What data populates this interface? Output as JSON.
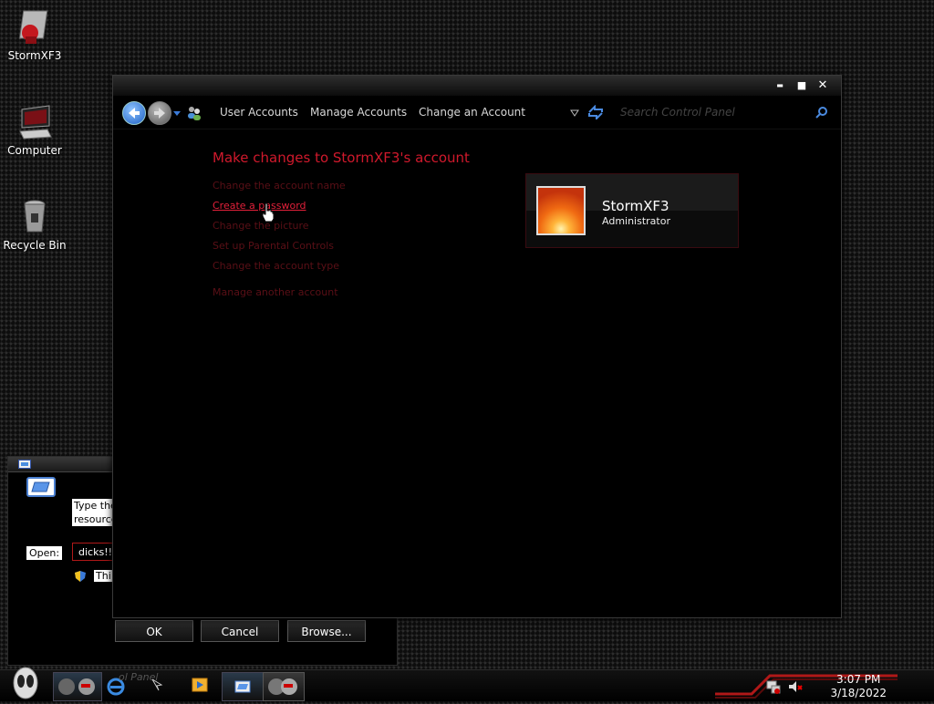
{
  "desktop": {
    "icons": [
      {
        "label": "StormXF3",
        "icon": "user-folder-icon"
      },
      {
        "label": "Computer",
        "icon": "computer-icon"
      },
      {
        "label": "Recycle Bin",
        "icon": "recycle-bin-icon"
      }
    ]
  },
  "run_dialog": {
    "description": "Type the resource",
    "open_label": "Open:",
    "open_value": "dicks!!!",
    "uac_note": "Thi",
    "ok_label": "OK",
    "cancel_label": "Cancel",
    "browse_label": "Browse..."
  },
  "window": {
    "breadcrumbs": [
      "User Accounts",
      "Manage Accounts",
      "Change an Account"
    ],
    "search_placeholder": "Search Control Panel",
    "controls": {
      "minimize": "▬",
      "maximize": "■",
      "close": "✕"
    }
  },
  "page": {
    "heading": "Make changes to StormXF3's account",
    "tasks": [
      "Change the account name",
      "Create a password",
      "Change the picture",
      "Set up Parental Controls",
      "Change the account type",
      "Manage another account"
    ],
    "active_task_index": 1
  },
  "account": {
    "name": "StormXF3",
    "role": "Administrator"
  },
  "taskbar": {
    "ghost_label": "ol Panel",
    "clock_time": "3:07 PM",
    "clock_date": "3/18/2022"
  },
  "colors": {
    "accent_red": "#d0192c",
    "link_dim": "#5a0f16",
    "background": "#000000"
  }
}
